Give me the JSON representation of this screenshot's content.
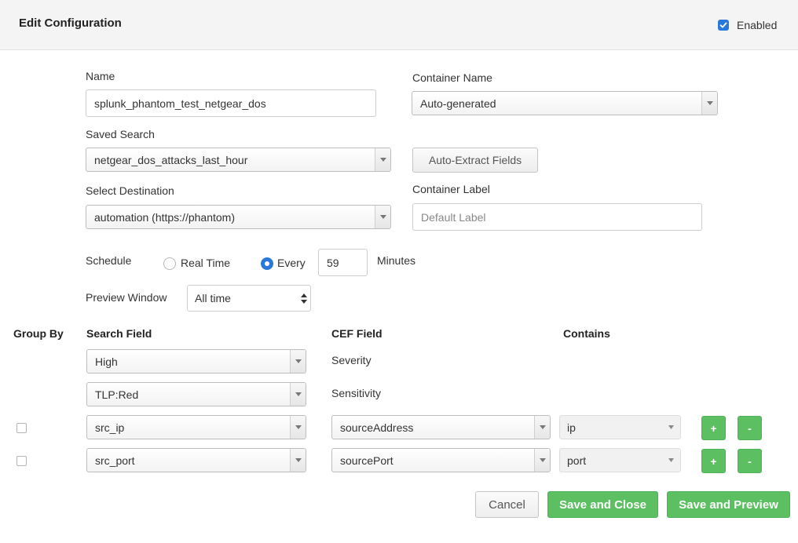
{
  "header": {
    "title": "Edit Configuration",
    "enabled_label": "Enabled",
    "enabled": true
  },
  "form": {
    "name_label": "Name",
    "name_value": "splunk_phantom_test_netgear_dos",
    "container_name_label": "Container Name",
    "container_name_value": "Auto-generated",
    "saved_search_label": "Saved Search",
    "saved_search_value": "netgear_dos_attacks_last_hour",
    "auto_extract_label": "Auto-Extract Fields",
    "destination_label": "Select Destination",
    "destination_value": "automation (https://phantom)",
    "container_label_label": "Container Label",
    "container_label_placeholder": "Default Label",
    "schedule_label": "Schedule",
    "schedule_realtime_label": "Real Time",
    "schedule_every_label": "Every",
    "schedule_every_value": "59",
    "schedule_unit": "Minutes",
    "schedule_selected": "Every",
    "preview_window_label": "Preview Window",
    "preview_window_value": "All time"
  },
  "mapping": {
    "headers": {
      "group_by": "Group By",
      "search_field": "Search Field",
      "cef_field": "CEF Field",
      "contains": "Contains"
    },
    "rows": [
      {
        "search_field": "High",
        "cef_field": "Severity"
      },
      {
        "search_field": "TLP:Red",
        "cef_field": "Sensitivity"
      },
      {
        "search_field": "src_ip",
        "cef_field": "sourceAddress",
        "contains": "ip",
        "group_by": false
      },
      {
        "search_field": "src_port",
        "cef_field": "sourcePort",
        "contains": "port",
        "group_by": false
      }
    ],
    "add_label": "+",
    "remove_label": "-"
  },
  "footer": {
    "cancel_label": "Cancel",
    "save_close_label": "Save and Close",
    "save_preview_label": "Save and Preview"
  },
  "colors": {
    "accent_blue": "#2a79d8",
    "success_green": "#5cbf62"
  },
  "icons": {
    "enabled_checkbox": "check-icon",
    "dropdown": "triangle-down-icon",
    "spinner": "up-down-arrows-icon"
  }
}
